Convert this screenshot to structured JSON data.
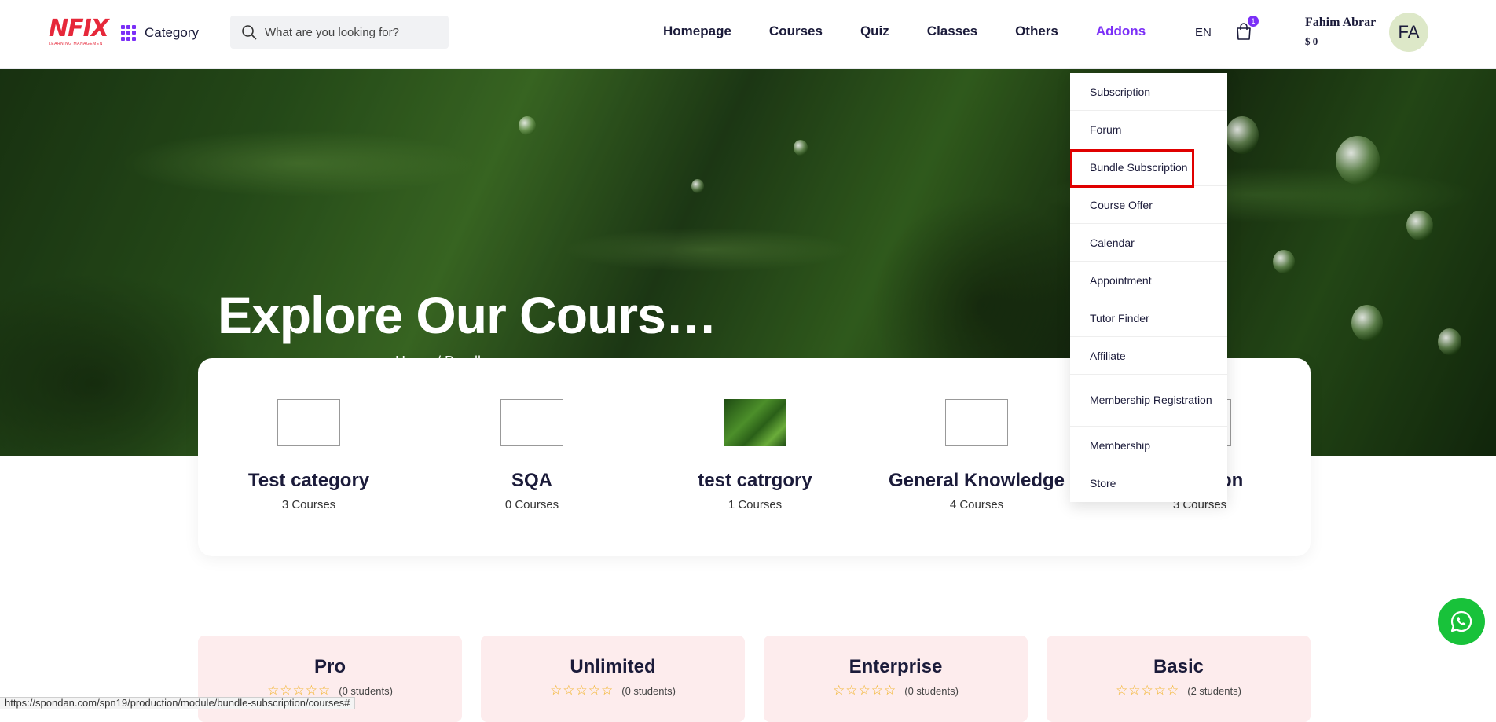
{
  "header": {
    "logo_text": "NFIX",
    "logo_subtext": "LEARNING MANAGEMENT",
    "category_label": "Category",
    "search_placeholder": "What are you looking for?",
    "nav": [
      "Homepage",
      "Courses",
      "Quiz",
      "Classes",
      "Others",
      "Addons"
    ],
    "active_nav": "Addons",
    "language": "EN",
    "cart_count": "1",
    "user_name": "Fahim Abrar",
    "user_balance": "$ 0",
    "avatar_initials": "FA"
  },
  "hero": {
    "title": "Explore Our Cours…",
    "breadcrumb": "Home / Bundle"
  },
  "categories": [
    {
      "name": "Test category",
      "count": "3 Courses"
    },
    {
      "name": "SQA",
      "count": "0 Courses"
    },
    {
      "name": "test catrgory",
      "count": "1 Courses"
    },
    {
      "name": "General Knowledge",
      "count": "4 Courses"
    },
    {
      "name": "cation",
      "count": "3 Courses"
    }
  ],
  "addons_menu": [
    "Subscription",
    "Forum",
    "Bundle Subscription",
    "Course Offer",
    "Calendar",
    "Appointment",
    "Tutor Finder",
    "Affiliate",
    "Membership Registration",
    "Membership",
    "Store"
  ],
  "highlighted_menu_item": "Bundle Subscription",
  "plans": [
    {
      "name": "Pro",
      "students": "(0 students)"
    },
    {
      "name": "Unlimited",
      "students": "(0 students)"
    },
    {
      "name": "Enterprise",
      "students": "(0 students)"
    },
    {
      "name": "Basic",
      "students": "(2 students)"
    }
  ],
  "status_url": "https://spondan.com/spn19/production/module/bundle-subscription/courses#",
  "colors": {
    "accent": "#7b2ff7",
    "brand_red": "#e6283a",
    "highlight_border": "#e00000",
    "plan_bg": "#fdeced",
    "whatsapp": "#18c23a",
    "star": "#f2b01e"
  }
}
